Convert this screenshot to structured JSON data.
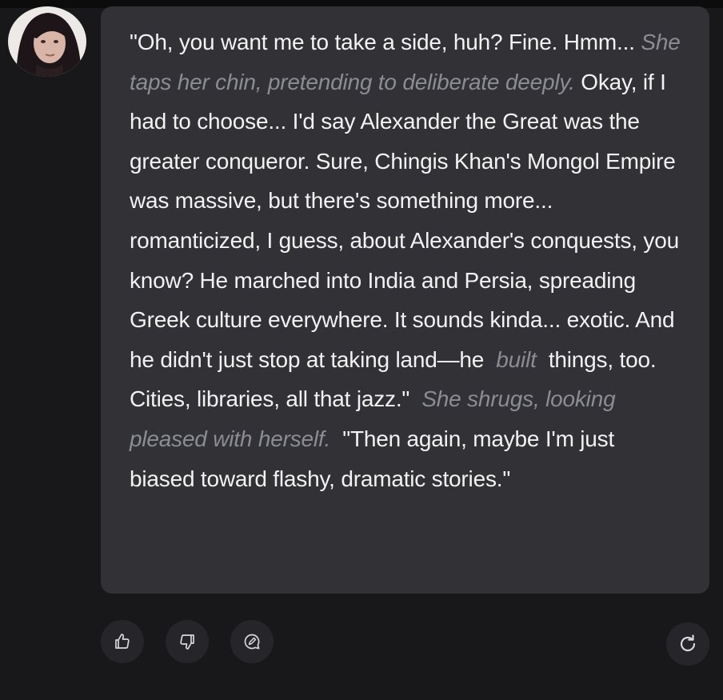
{
  "message": {
    "seg1": "\"Oh, you want me to take a side, huh? Fine. Hmm... ",
    "act1": "She taps her chin, pretending to deliberate deeply.",
    "seg2": " Okay, if I had to choose... I'd say Alexander the Great was the greater conqueror. Sure, Chingis Khan's Mongol Empire was massive, but there's something more... romanticized, I guess, about Alexander's conquests, you know? He marched into India and Persia, spreading Greek culture everywhere. It sounds kinda... exotic. And he didn't just stop at taking land—he ",
    "act2": " built ",
    "seg3": " things, too. Cities, libraries, all that jazz.\" ",
    "act3": " She shrugs, looking pleased with herself.",
    "seg4": "  \"Then again, maybe I'm just biased toward flashy, dramatic stories.\""
  },
  "actions": {
    "like_icon": "thumbs-up-icon",
    "dislike_icon": "thumbs-down-icon",
    "annotate_icon": "annotate-icon",
    "regenerate_icon": "refresh-icon"
  },
  "colors": {
    "background": "#18181b",
    "bubble": "#313136",
    "text": "#f2f2f3",
    "action_text": "#8c8c94"
  }
}
